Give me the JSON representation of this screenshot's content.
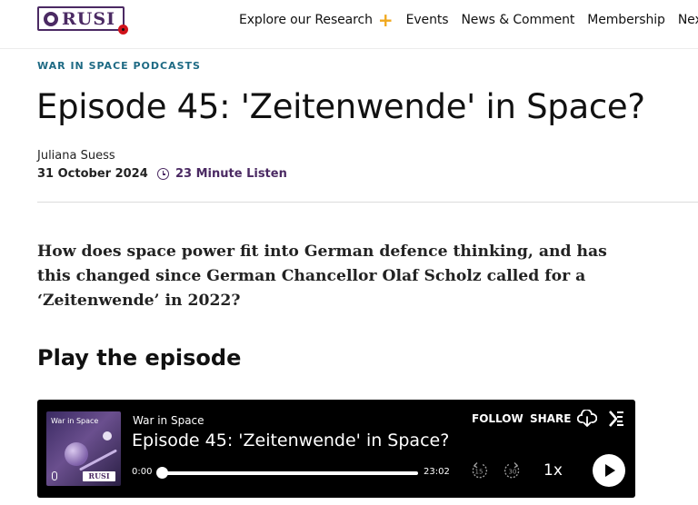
{
  "header": {
    "logo_text": "RUSI",
    "nav": [
      {
        "label": "Explore our Research",
        "has_plus": true
      },
      {
        "label": "Events"
      },
      {
        "label": "News & Comment"
      },
      {
        "label": "Membership"
      },
      {
        "label": "NextGen"
      }
    ],
    "plus_symbol": "+"
  },
  "article": {
    "category": "WAR IN SPACE PODCASTS",
    "title": "Episode 45: 'Zeitenwende' in Space?",
    "author": "Juliana Suess",
    "date": "31 October 2024",
    "listen_time": "23 Minute Listen",
    "lede": "How does space power fit into German defence thinking, and has this changed since German Chancellor Olaf Scholz called for a ‘Zeitenwende’ in 2022?",
    "section_heading": "Play the episode"
  },
  "player": {
    "cover_title": "War in Space",
    "cover_logo": "RUSI",
    "show_name": "War in Space",
    "episode_title": "Episode 45: 'Zeitenwende' in Space?",
    "follow_label": "FOLLOW",
    "share_label": "SHARE",
    "time_elapsed": "0:00",
    "time_total": "23:02",
    "rewind_seconds": "15",
    "forward_seconds": "30",
    "speed": "1x",
    "progress": 0
  },
  "colors": {
    "brand_purple": "#4b2a63",
    "category_teal": "#1e6a84",
    "accent_gold": "#f0a81e",
    "poppy_red": "#d0121b",
    "player_bg": "#000000"
  }
}
